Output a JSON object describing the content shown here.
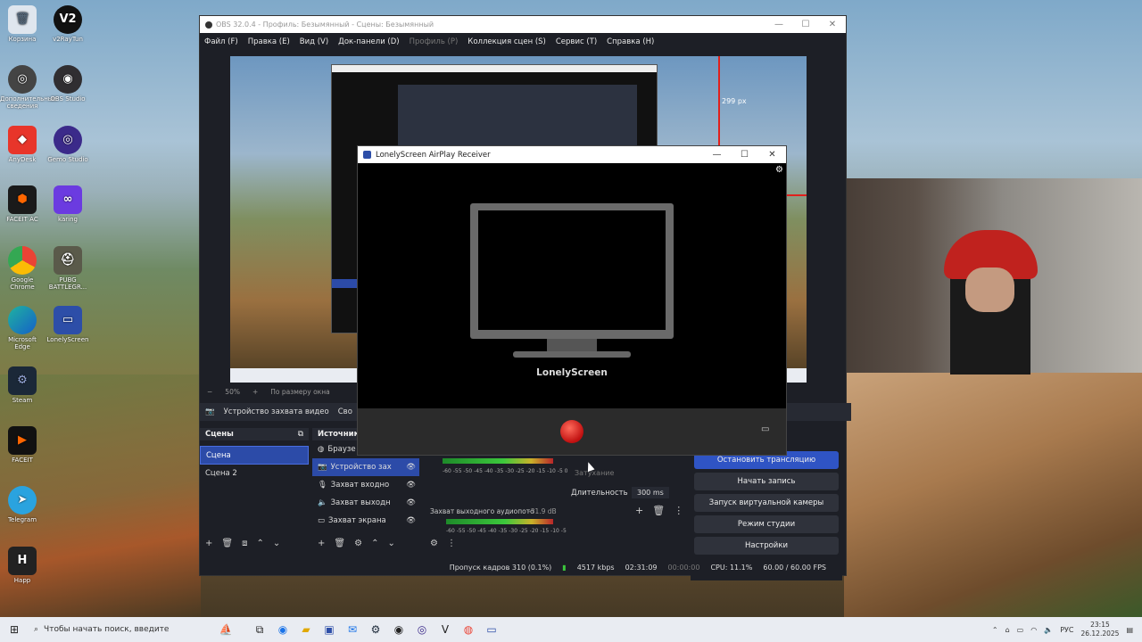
{
  "desktop": {
    "icons_col1": [
      "Корзина",
      "Дополнительные сведения",
      "AnyDesk",
      "FACEIT AC",
      "Google Chrome",
      "Microsoft Edge",
      "Steam",
      "FACEIT",
      "Telegram",
      "Happ"
    ],
    "icons_col2": [
      "v2RayTun",
      "OBS Studio",
      "Gemo Studio",
      "karing",
      "PUBG BATTLEGR...",
      "LonelyScreen"
    ]
  },
  "obs": {
    "title": "OBS 32.0.4 - Профиль: Безымянный - Сцены: Безымянный",
    "menu": [
      "Файл (F)",
      "Правка (E)",
      "Вид (V)",
      "Док-панели (D)",
      "Профиль (P)",
      "Коллекция сцен (S)",
      "Сервис (T)",
      "Справка (H)"
    ],
    "preview_label": "299 px",
    "zoom": "50%",
    "zoom_mode": "По размеру окна",
    "source_bar": {
      "selected": "Устройство захвата видео",
      "btn": "Сво"
    },
    "scenes_header": "Сцены",
    "scenes": [
      "Сцена",
      "Сцена 2"
    ],
    "sources_header": "Источник",
    "sources": [
      "Браузе",
      "Устройство зах",
      "Захват входно",
      "Захват выходн",
      "Захват экрана"
    ],
    "mixer": {
      "track": "Захват выходного аудиопото",
      "db": "-31.9 dB",
      "ticks": "-60 -55 -50 -45 -40 -35 -30 -25 -20 -15 -10 -5 0"
    },
    "transition": {
      "label_top": "Затухание",
      "duration_label": "Длительность",
      "duration_value": "300 ms"
    },
    "controls": [
      "Остановить трансляцию",
      "Начать запись",
      "Запуск виртуальной камеры",
      "Режим студии",
      "Настройки"
    ],
    "status": {
      "dropped": "Пропуск кадров 310 (0.1%)",
      "bitrate": "4517 kbps",
      "stream_time": "02:31:09",
      "rec_time": "00:00:00",
      "cpu": "CPU: 11.1%",
      "fps": "60.00 / 60.00 FPS"
    }
  },
  "lonelyscreen": {
    "title": "LonelyScreen AirPlay Receiver",
    "brand": "LonelyScreen"
  },
  "taskbar": {
    "search_placeholder": "Чтобы начать поиск, введите",
    "lang": "РУС",
    "time": "23:15",
    "date": "26.12.2025"
  }
}
